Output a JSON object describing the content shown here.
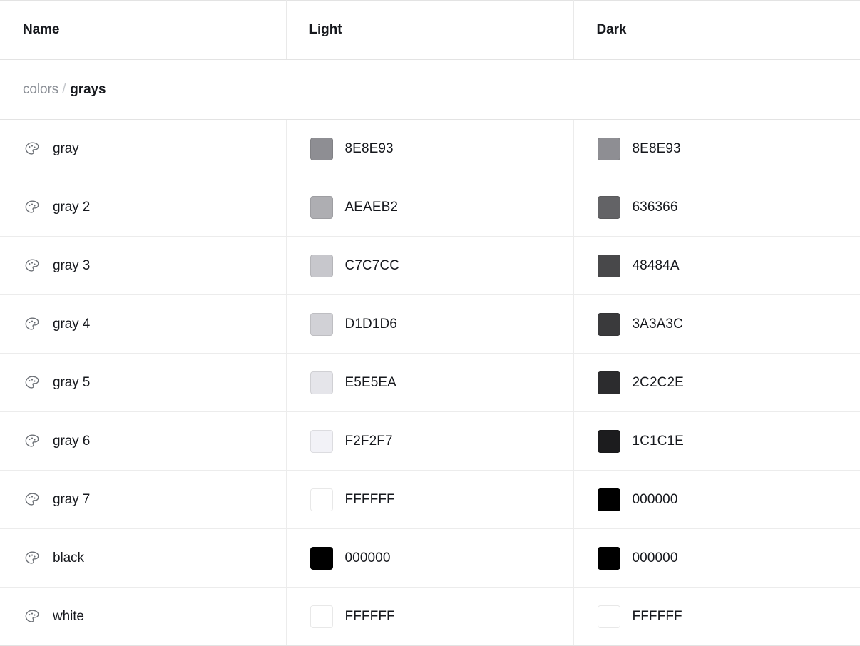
{
  "table": {
    "columns": [
      {
        "label": "Name",
        "key": "name"
      },
      {
        "label": "Light",
        "key": "light"
      },
      {
        "label": "Dark",
        "key": "dark"
      }
    ],
    "group": {
      "parent": "colors",
      "separator": "/",
      "name": "grays"
    },
    "row_icon": "palette-icon",
    "rows": [
      {
        "name": "gray",
        "light_hex": "8E8E93",
        "light_color": "#8E8E93",
        "dark_hex": "8E8E93",
        "dark_color": "#8E8E93"
      },
      {
        "name": "gray 2",
        "light_hex": "AEAEB2",
        "light_color": "#AEAEB2",
        "dark_hex": "636366",
        "dark_color": "#636366"
      },
      {
        "name": "gray 3",
        "light_hex": "C7C7CC",
        "light_color": "#C7C7CC",
        "dark_hex": "48484A",
        "dark_color": "#48484A"
      },
      {
        "name": "gray 4",
        "light_hex": "D1D1D6",
        "light_color": "#D1D1D6",
        "dark_hex": "3A3A3C",
        "dark_color": "#3A3A3C"
      },
      {
        "name": "gray 5",
        "light_hex": "E5E5EA",
        "light_color": "#E5E5EA",
        "dark_hex": "2C2C2E",
        "dark_color": "#2C2C2E"
      },
      {
        "name": "gray 6",
        "light_hex": "F2F2F7",
        "light_color": "#F2F2F7",
        "dark_hex": "1C1C1E",
        "dark_color": "#1C1C1E"
      },
      {
        "name": "gray 7",
        "light_hex": "FFFFFF",
        "light_color": "#FFFFFF",
        "dark_hex": "000000",
        "dark_color": "#000000"
      },
      {
        "name": "black",
        "light_hex": "000000",
        "light_color": "#000000",
        "dark_hex": "000000",
        "dark_color": "#000000"
      },
      {
        "name": "white",
        "light_hex": "FFFFFF",
        "light_color": "#FFFFFF",
        "dark_hex": "FFFFFF",
        "dark_color": "#FFFFFF"
      }
    ]
  }
}
